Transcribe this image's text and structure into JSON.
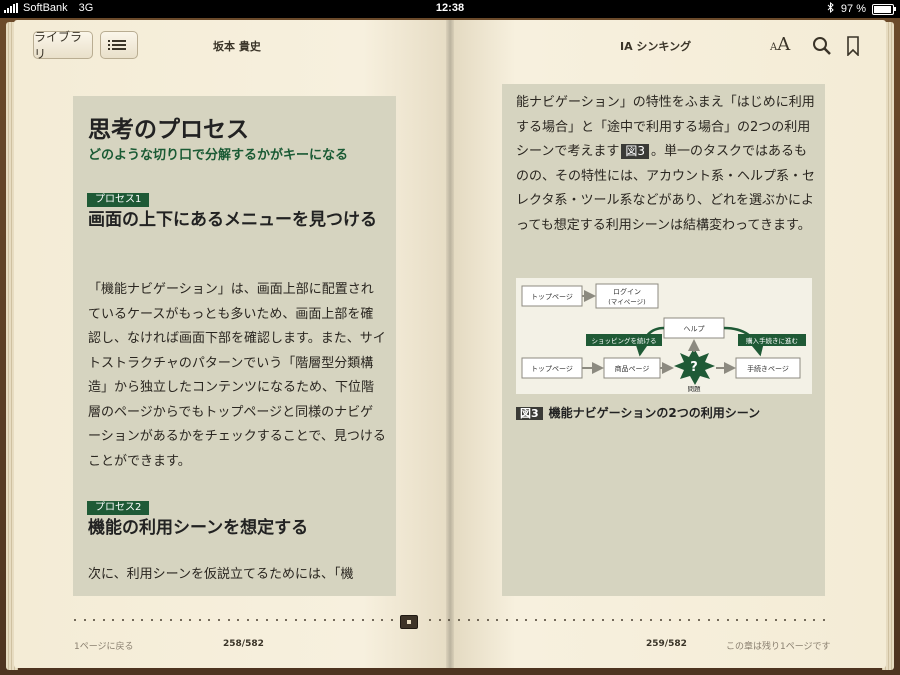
{
  "status": {
    "carrier": "SoftBank",
    "network": "3G",
    "time": "12:38",
    "battery_text": "97 %",
    "battery_level": 0.97
  },
  "toolbar": {
    "library_label": "ライブラリ",
    "author": "坂本 貴史",
    "book_title": "IA シンキング",
    "font_small": "A",
    "font_large": "A"
  },
  "left": {
    "chapter_title": "思考のプロセス",
    "chapter_subtitle": "どのような切り口で分解するかがキーになる",
    "process1_tag": "プロセス1",
    "process1_title": "画面の上下にあるメニューを見つける",
    "process1_body": "「機能ナビゲーション」は、画面上部に配置されているケースがもっとも多いため、画面上部を確認し、なければ画面下部を確認します。また、サイトストラクチャのパターンでいう「階層型分類構造」から独立したコンテンツになるため、下位階層のページからでもトップページと同様のナビゲーションがあるかをチェックすることで、見つけることができます。",
    "process2_tag": "プロセス2",
    "process2_title": "機能の利用シーンを想定する",
    "process2_body": "次に、利用シーンを仮説立てるためには、「機"
  },
  "right": {
    "body_before": "能ナビゲーション」の特性をふまえ「はじめに利用する場合」と「途中で利用する場合」の2つの利用シーンで考えます",
    "figref": "図3",
    "body_after": "。単一のタスクではあるものの、その特性には、アカウント系・ヘルプ系・セレクタ系・ツール系などがあり、どれを選ぶかによっても想定する利用シーンは結構変わってきます。",
    "figure": {
      "top_left": "トップページ",
      "login_line1": "ログイン",
      "login_line2": "(マイページ)",
      "help": "ヘルプ",
      "continue_shopping": "ショッピングを続ける",
      "proceed_purchase": "購入手続きに進む",
      "bottom_left": "トップページ",
      "product": "商品ページ",
      "question": "?",
      "problem": "問題",
      "procedure": "手続きページ"
    },
    "caption_label": "図3",
    "caption_text": "機能ナビゲーションの2つの利用シーン"
  },
  "footer": {
    "back_label": "1ページに戻る",
    "left_page": "258/582",
    "right_page": "259/582",
    "remaining": "この章は残り1ページです"
  }
}
